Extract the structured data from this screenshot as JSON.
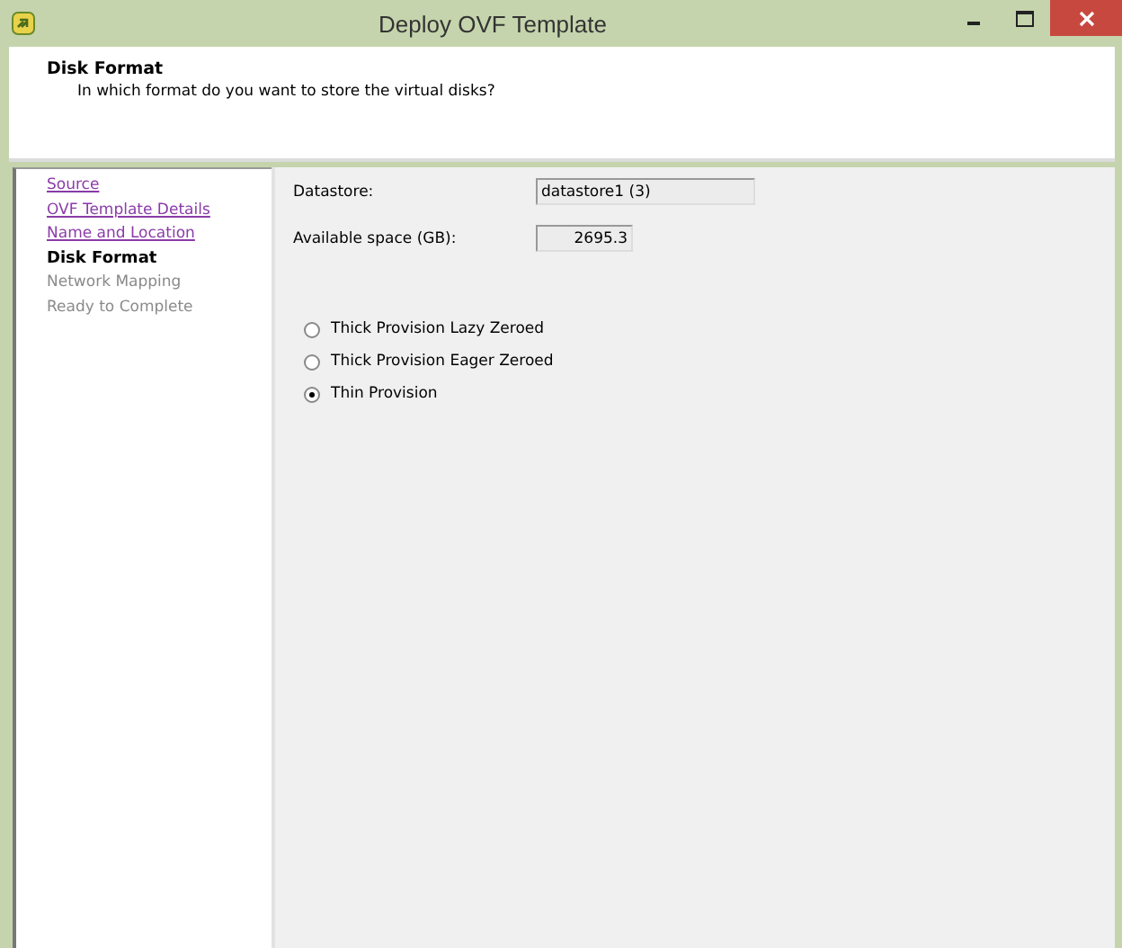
{
  "window": {
    "title": "Deploy OVF Template"
  },
  "header": {
    "title": "Disk Format",
    "subtitle": "In which format do you want to store the virtual disks?"
  },
  "steps": [
    {
      "label": "Source",
      "kind": "link"
    },
    {
      "label": "OVF Template Details",
      "kind": "link"
    },
    {
      "label": "Name and Location",
      "kind": "link"
    },
    {
      "label": "Disk Format",
      "kind": "current"
    },
    {
      "label": "Network Mapping",
      "kind": "pending"
    },
    {
      "label": "Ready to Complete",
      "kind": "pending"
    }
  ],
  "fields": [
    {
      "label": "Datastore:",
      "value": "datastore1 (3)",
      "kind": "wide"
    },
    {
      "label": "Available space (GB):",
      "value": "2695.3",
      "kind": "number"
    }
  ],
  "disk_formats": [
    {
      "label": "Thick Provision Lazy Zeroed",
      "selected": false
    },
    {
      "label": "Thick Provision Eager Zeroed",
      "selected": false
    },
    {
      "label": "Thin Provision",
      "selected": true
    }
  ]
}
